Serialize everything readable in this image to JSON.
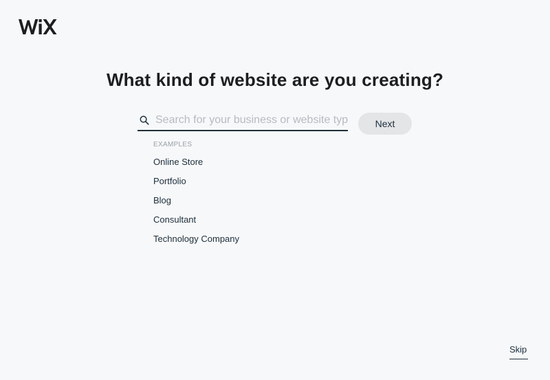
{
  "brand": {
    "logo_text": "WiX",
    "logo_icon": "wix-logo"
  },
  "main": {
    "headline": "What kind of website are you creating?"
  },
  "search": {
    "icon": "search-icon",
    "value": "",
    "placeholder": "Search for your business or website type"
  },
  "actions": {
    "next_label": "Next",
    "skip_label": "Skip"
  },
  "examples": {
    "header": "EXAMPLES",
    "items": [
      {
        "label": "Online Store"
      },
      {
        "label": "Portfolio"
      },
      {
        "label": "Blog"
      },
      {
        "label": "Consultant"
      },
      {
        "label": "Technology Company"
      }
    ]
  },
  "colors": {
    "background": "#f7f8fa",
    "text": "#20303c",
    "button_bg": "#e4e5e7",
    "placeholder": "#b6bac0",
    "muted": "#9aa0a6"
  }
}
